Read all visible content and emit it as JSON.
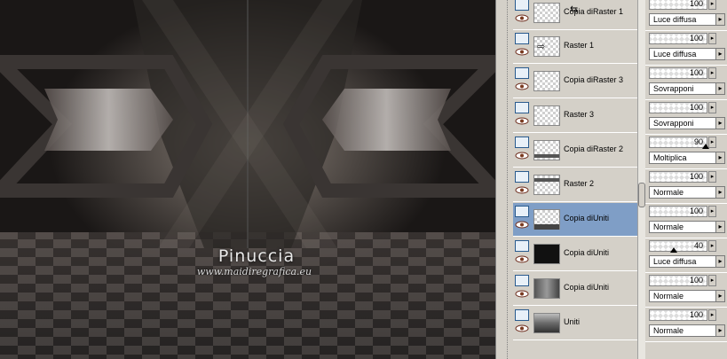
{
  "canvas": {
    "watermark_title": "Pinuccia",
    "watermark_url": "www.maidiregrafica.eu"
  },
  "layers": [
    {
      "name": "Copia diRaster 1",
      "thumb": "transparent",
      "icon": "arrow-left-right-icon",
      "selected": false
    },
    {
      "name": "Raster 1",
      "thumb": "transparent",
      "icon": "arrow-right-icon",
      "selected": false
    },
    {
      "name": "Copia diRaster 3",
      "thumb": "transparent",
      "icon": "",
      "selected": false
    },
    {
      "name": "Raster 3",
      "thumb": "transparent",
      "icon": "",
      "selected": false
    },
    {
      "name": "Copia diRaster 2",
      "thumb": "transparent",
      "icon": "",
      "selected": false
    },
    {
      "name": "Raster 2",
      "thumb": "transparent",
      "icon": "",
      "selected": false
    },
    {
      "name": "Copia diUniti",
      "thumb": "transparent",
      "icon": "",
      "selected": true
    },
    {
      "name": "Copia diUniti",
      "thumb": "dark",
      "icon": "",
      "selected": false
    },
    {
      "name": "Copia diUniti",
      "thumb": "photo2",
      "icon": "",
      "selected": false
    },
    {
      "name": "Uniti",
      "thumb": "photo",
      "icon": "",
      "selected": false
    }
  ],
  "properties": [
    {
      "opacity": "100",
      "blend": "Luce diffusa"
    },
    {
      "opacity": "100",
      "blend": "Luce diffusa"
    },
    {
      "opacity": "100",
      "blend": "Sovrapponi"
    },
    {
      "opacity": "100",
      "blend": "Sovrapponi"
    },
    {
      "opacity": "90",
      "blend": "Moltiplica"
    },
    {
      "opacity": "100",
      "blend": "Normale"
    },
    {
      "opacity": "100",
      "blend": "Normale"
    },
    {
      "opacity": "40",
      "blend": "Luce diffusa"
    },
    {
      "opacity": "100",
      "blend": "Normale"
    },
    {
      "opacity": "100",
      "blend": "Normale"
    }
  ],
  "colors": {
    "panel": "#d4d0c8",
    "selected": "#7f9ec6"
  }
}
